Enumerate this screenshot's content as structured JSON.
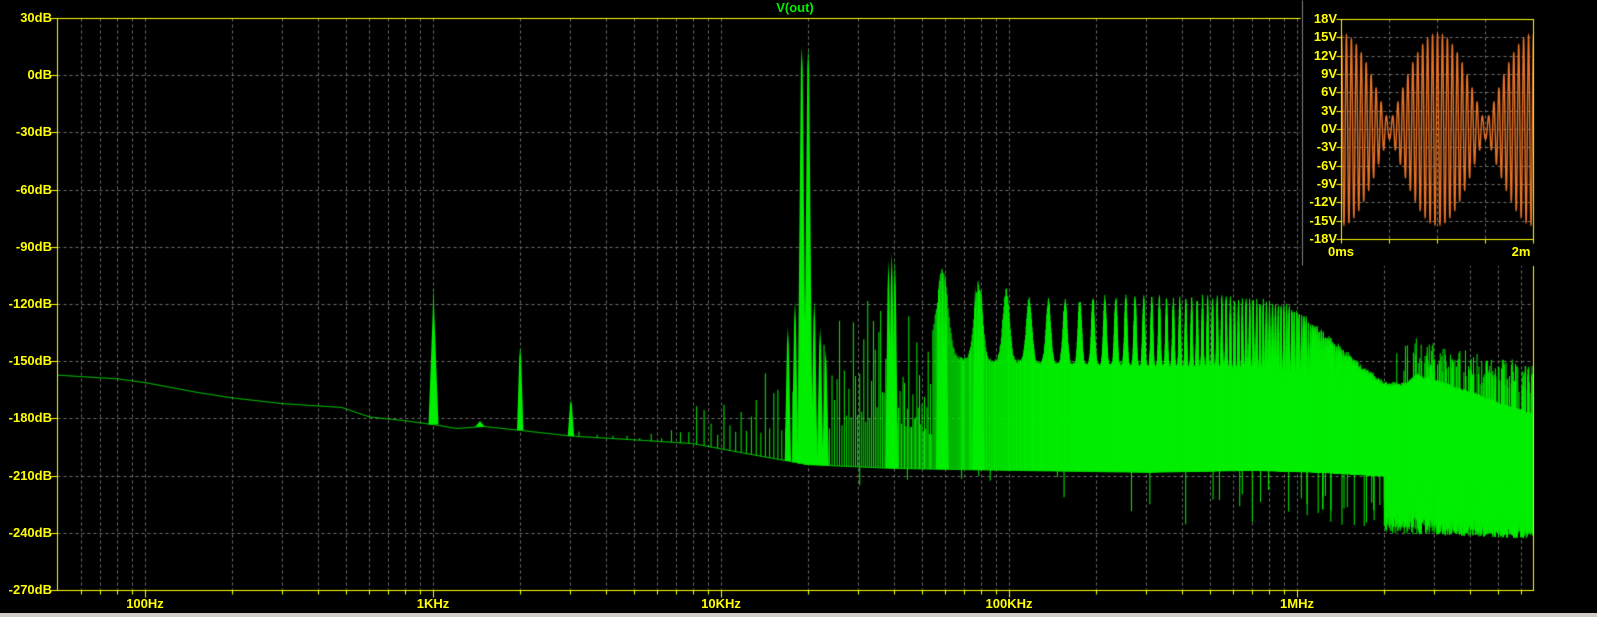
{
  "window": {
    "background": "#000000",
    "bottom_edge_color": "#D0CCC4"
  },
  "colors": {
    "axis": "#FFFF00",
    "grid": "#6E6E6E",
    "trace_main": "#00EE00",
    "trace_inset": "#E87428",
    "title": "#00EE00",
    "panel_divider": "#7F7F7F"
  },
  "chart_data": {
    "type": "line",
    "title": "V(out)",
    "description": "FFT magnitude spectrum of V(out), log frequency axis, dB scale",
    "x_axis": {
      "scale": "log",
      "unit": "Hz",
      "min_hz": 50,
      "max_hz": 6600000,
      "tick_labels": [
        "100Hz",
        "1KHz",
        "10KHz",
        "100KHz",
        "1MHz"
      ],
      "tick_values_hz": [
        100,
        1000,
        10000,
        100000,
        1000000
      ],
      "grid": "dashed"
    },
    "y_axis": {
      "unit": "dB",
      "min_db": -270,
      "max_db": 30,
      "step_db": 30,
      "tick_labels": [
        "30dB",
        "0dB",
        "-30dB",
        "-60dB",
        "-90dB",
        "-120dB",
        "-150dB",
        "-180dB",
        "-210dB",
        "-240dB",
        "-270dB"
      ],
      "tick_values_db": [
        30,
        0,
        -30,
        -60,
        -90,
        -120,
        -150,
        -180,
        -210,
        -240,
        -270
      ],
      "grid": "dashed"
    },
    "major_peaks": [
      {
        "f_hz": 1000,
        "db": -110
      },
      {
        "f_hz": 1450,
        "db": -181
      },
      {
        "f_hz": 2000,
        "db": -142
      },
      {
        "f_hz": 3000,
        "db": -170
      },
      {
        "f_hz": 17000,
        "db": -132
      },
      {
        "f_hz": 18000,
        "db": -118
      },
      {
        "f_hz": 19000,
        "db": 15
      },
      {
        "f_hz": 20000,
        "db": 15
      },
      {
        "f_hz": 21000,
        "db": -118
      },
      {
        "f_hz": 22000,
        "db": -132
      },
      {
        "f_hz": 23000,
        "db": -144
      },
      {
        "f_hz": 38000,
        "db": -97
      },
      {
        "f_hz": 39000,
        "db": -93
      },
      {
        "f_hz": 40000,
        "db": -96
      },
      {
        "f_hz": 57000,
        "db": -104
      },
      {
        "f_hz": 58500,
        "db": -100
      },
      {
        "f_hz": 60000,
        "db": -103
      },
      {
        "f_hz": 76000,
        "db": -110
      },
      {
        "f_hz": 78000,
        "db": -107
      },
      {
        "f_hz": 80000,
        "db": -111
      }
    ],
    "noise_floor_db": [
      [
        49,
        -157
      ],
      [
        80,
        -159
      ],
      [
        100,
        -161
      ],
      [
        150,
        -166
      ],
      [
        200,
        -169
      ],
      [
        300,
        -172
      ],
      [
        480,
        -174
      ],
      [
        600,
        -179
      ],
      [
        800,
        -181
      ],
      [
        1000,
        -183
      ],
      [
        1200,
        -185
      ],
      [
        1500,
        -184
      ],
      [
        2000,
        -186
      ],
      [
        3000,
        -189
      ],
      [
        5000,
        -191
      ],
      [
        8000,
        -193
      ],
      [
        12000,
        -198
      ],
      [
        20000,
        -204
      ],
      [
        40000,
        -206
      ],
      [
        100000,
        -207
      ],
      [
        300000,
        -208
      ],
      [
        700000,
        -207
      ],
      [
        1200000,
        -208
      ],
      [
        2000000,
        -210
      ],
      [
        3000000,
        -211
      ],
      [
        4500000,
        -212
      ],
      [
        6600000,
        -213
      ]
    ],
    "spur_envelope_db": [
      [
        3300,
        -186
      ],
      [
        4000,
        -188
      ],
      [
        5000,
        -189
      ],
      [
        6500,
        -184
      ],
      [
        8000,
        -177
      ],
      [
        10000,
        -169
      ],
      [
        12000,
        -162
      ],
      [
        14000,
        -155
      ],
      [
        16000,
        -147
      ],
      [
        17500,
        -136
      ],
      [
        18500,
        -140
      ],
      [
        21500,
        -140
      ],
      [
        23000,
        -138
      ],
      [
        25000,
        -131
      ],
      [
        28000,
        -127
      ],
      [
        32000,
        -121
      ],
      [
        36000,
        -117
      ],
      [
        40000,
        -121
      ],
      [
        44000,
        -127
      ],
      [
        50000,
        -136
      ],
      [
        56000,
        -146
      ],
      [
        70000,
        -149
      ],
      [
        100000,
        -150
      ],
      [
        200000,
        -152
      ],
      [
        400000,
        -153
      ],
      [
        700000,
        -154
      ],
      [
        1000000,
        -160
      ],
      [
        1300000,
        -165
      ],
      [
        1600000,
        -168
      ],
      [
        2000000,
        -170
      ],
      [
        2600000,
        -166
      ],
      [
        3200000,
        -168
      ],
      [
        4000000,
        -172
      ],
      [
        5000000,
        -176
      ],
      [
        6600000,
        -180
      ]
    ],
    "cluster_envelope_db": [
      [
        56000,
        -104
      ],
      [
        60000,
        -101
      ],
      [
        70000,
        -112
      ],
      [
        80000,
        -109
      ],
      [
        100000,
        -114
      ],
      [
        130000,
        -118
      ],
      [
        200000,
        -117
      ],
      [
        300000,
        -116
      ],
      [
        400000,
        -118
      ],
      [
        500000,
        -116
      ],
      [
        650000,
        -118
      ],
      [
        800000,
        -119
      ],
      [
        950000,
        -122
      ],
      [
        1050000,
        -127
      ],
      [
        1200000,
        -134
      ],
      [
        1450000,
        -145
      ],
      [
        1700000,
        -154
      ],
      [
        2000000,
        -162
      ],
      [
        2300000,
        -163
      ],
      [
        2600000,
        -158
      ],
      [
        3000000,
        -161
      ],
      [
        3600000,
        -165
      ],
      [
        4300000,
        -169
      ],
      [
        5200000,
        -174
      ],
      [
        6600000,
        -179
      ]
    ],
    "comb_spacing_hz": 500,
    "cluster_spacing_hz": 19500,
    "inset": {
      "type": "line",
      "description": "time-domain two-tone waveform of V(out)",
      "x_axis": {
        "start_label": "0ms",
        "end_label": "2m",
        "min_ms": 0,
        "max_ms": 2
      },
      "y_axis": {
        "unit": "V",
        "min_v": -18,
        "max_v": 18,
        "step_v": 3,
        "tick_labels": [
          "18V",
          "15V",
          "12V",
          "9V",
          "6V",
          "3V",
          "0V",
          "-3V",
          "-6V",
          "-9V",
          "-12V",
          "-15V",
          "-18V"
        ],
        "tick_values_v": [
          18,
          15,
          12,
          9,
          6,
          3,
          0,
          -3,
          -6,
          -9,
          -12,
          -15,
          -18
        ]
      },
      "signal": {
        "kind": "two-tone sum",
        "tones": [
          {
            "f_hz": 19000,
            "amp_v": 8.6
          },
          {
            "f_hz": 20000,
            "amp_v": 7.0
          }
        ],
        "envelope_max_v": 15.6,
        "envelope_min_v": 1.6
      }
    }
  }
}
